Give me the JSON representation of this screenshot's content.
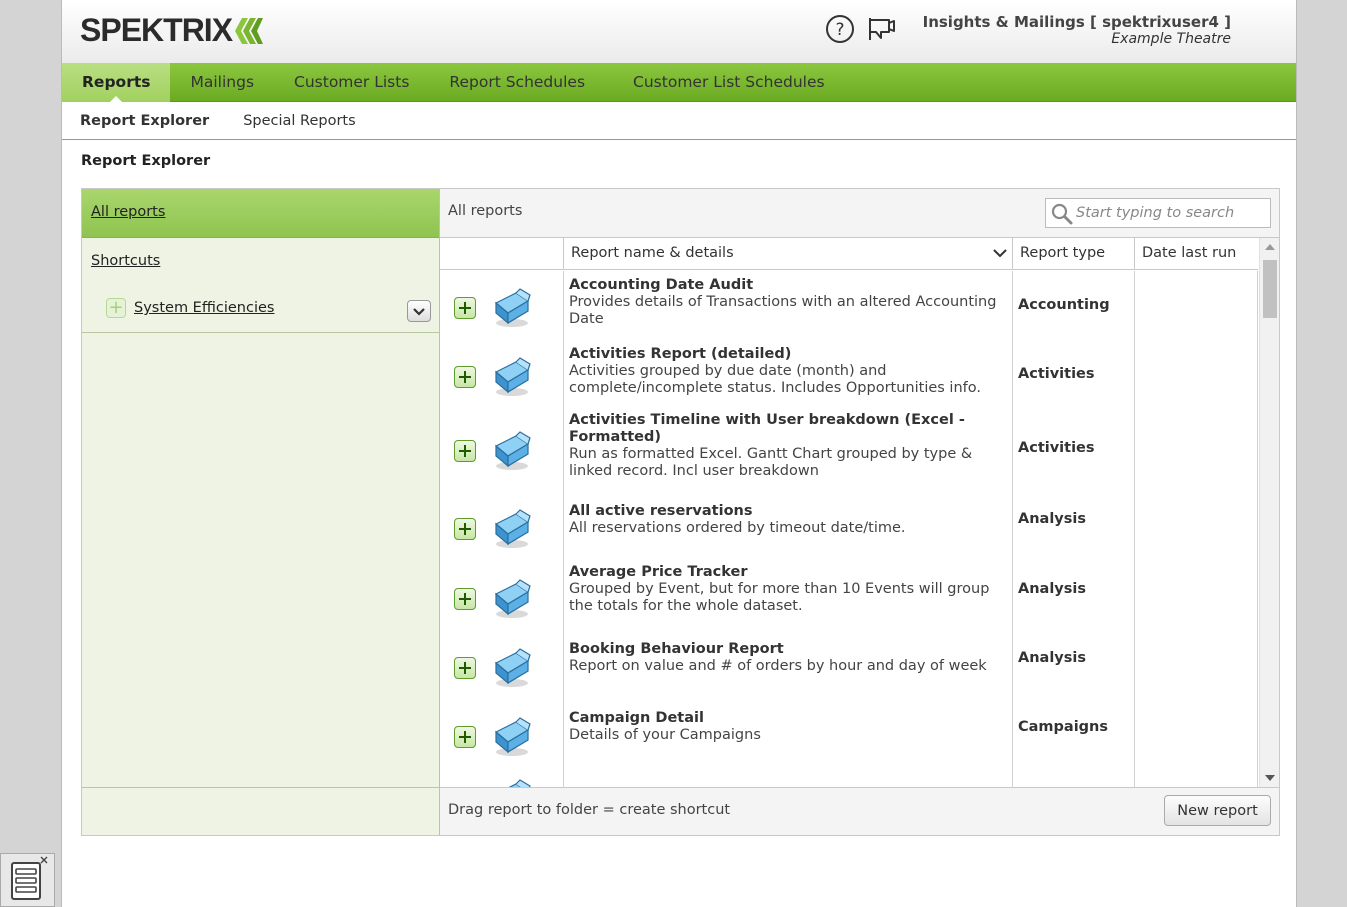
{
  "header": {
    "logo_text": "SPEKTRIX",
    "user_line1": "Insights & Mailings [ spektrixuser4 ]",
    "user_line2": "Example Theatre",
    "icons": [
      "help-icon",
      "announcement-icon"
    ]
  },
  "main_nav": {
    "tabs": [
      {
        "label": "Reports",
        "active": true
      },
      {
        "label": "Mailings"
      },
      {
        "label": "Customer Lists"
      },
      {
        "label": "Report Schedules"
      },
      {
        "label": "Customer List Schedules"
      }
    ]
  },
  "sub_nav": {
    "tabs": [
      {
        "label": "Report Explorer",
        "active": true
      },
      {
        "label": "Special Reports"
      }
    ]
  },
  "page_title": "Report Explorer",
  "left_pane": {
    "all_reports": "All reports",
    "shortcuts": "Shortcuts",
    "folder": "System Efficiencies"
  },
  "right_pane": {
    "title": "All reports",
    "search_placeholder": "Start typing to search",
    "columns": {
      "name": "Report name & details",
      "type": "Report type",
      "date": "Date last run"
    },
    "rows": [
      {
        "name": "Accounting Date Audit",
        "desc": "Provides details of Transactions with an altered Accounting Date",
        "type": "Accounting"
      },
      {
        "name": "Activities Report (detailed)",
        "desc": "Activities grouped by due date (month) and complete/incomplete status. Includes Opportunities info.",
        "type": "Activities"
      },
      {
        "name": "Activities Timeline with User breakdown (Excel - Formatted)",
        "desc": "Run as formatted Excel. Gantt Chart grouped by type & linked record. Incl user breakdown",
        "type": "Activities"
      },
      {
        "name": "All active reservations",
        "desc": "All reservations ordered by timeout date/time.",
        "type": "Analysis"
      },
      {
        "name": "Average Price Tracker",
        "desc": "Grouped by Event, but for more than 10 Events will group the totals for the whole dataset.",
        "type": "Analysis"
      },
      {
        "name": "Booking Behaviour Report",
        "desc": "Report on value and # of orders by hour and day of week",
        "type": "Analysis"
      },
      {
        "name": "Campaign Detail",
        "desc": "Details of your Campaigns",
        "type": "Campaigns"
      }
    ],
    "footer_hint": "Drag report to folder = create shortcut",
    "new_report": "New report"
  },
  "colors": {
    "nav_green": "#7cbb33",
    "nav_active": "#b9df82",
    "left_pane_bg": "#eff3e4",
    "logo_chevron": "#8cc63f"
  }
}
